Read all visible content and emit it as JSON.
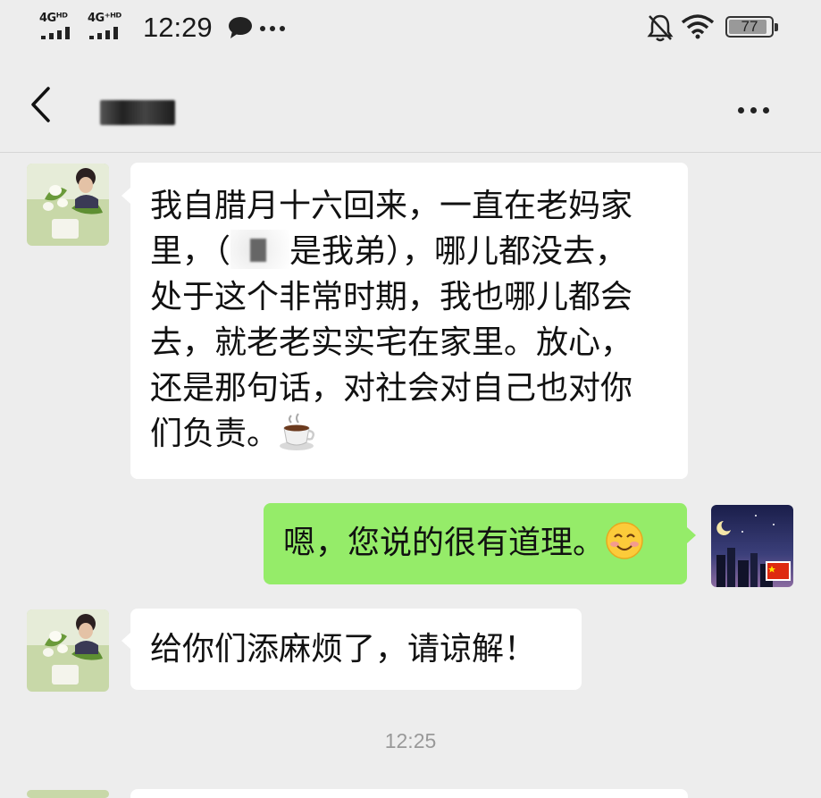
{
  "status_bar": {
    "signal1": "4Gᴴᴰ",
    "signal2": "4G⁺ᴴᴰ",
    "time": "12:29",
    "battery": "77"
  },
  "header": {
    "back_icon": "chevron-left-icon",
    "more_icon": "more-dots-icon"
  },
  "messages": [
    {
      "side": "in",
      "lines": [
        "我自腊月十六回来，一直在老妈家",
        "里，（",
        "是我弟），哪儿都没去，",
        "处于这个非常时期，我也哪儿都会",
        "去，就老老实实宅在家里。放心，",
        "还是那句话，对社会对自己也对你",
        "们负责。"
      ],
      "emoji": "coffee-icon"
    },
    {
      "side": "out",
      "text": "嗯，您说的很有道理。",
      "emoji": "smile-icon"
    },
    {
      "side": "in",
      "text": "给你们添麻烦了，请谅解！"
    }
  ],
  "timestamp": "12:25"
}
